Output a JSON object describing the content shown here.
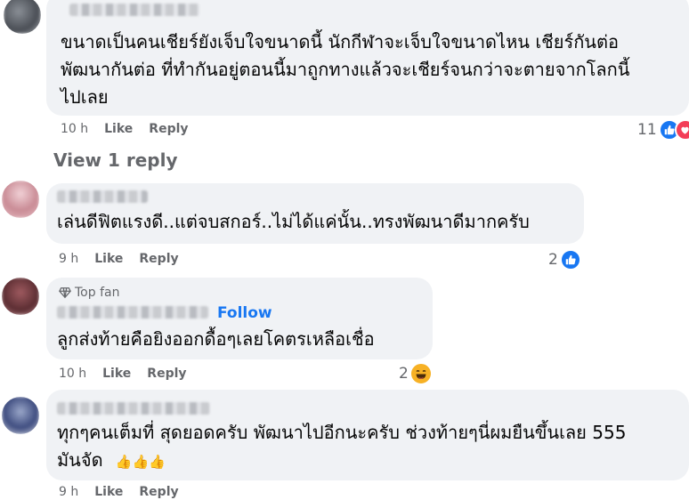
{
  "comments": [
    {
      "text_lines": [
        "ขนาดเป็นคนเชียร์ยังเจ็บใจขนาดนี้ นักกีฬาจะเจ็บใจขนาดไหน เชียร์กันต่อ",
        "พัฒนากันต่อ ที่ทำกันอยู่ตอนนี้มาถูกทางแล้วจะเชียร์จนกว่าจะตายจากโลกนี้",
        "ไปเลย"
      ],
      "time": "10 h",
      "like_label": "Like",
      "reply_label": "Reply",
      "reaction_count": "11",
      "view_replies": "View 1 reply"
    },
    {
      "text_lines": [
        "เล่นดีฟิตแรงดี..แต่จบสกอร์..ไม่ได้แค่นั้น..ทรงพัฒนาดีมากครับ"
      ],
      "time": "9 h",
      "like_label": "Like",
      "reply_label": "Reply",
      "reaction_count": "2"
    },
    {
      "badge": "Top fan",
      "follow_label": "Follow",
      "text_lines": [
        "ลูกส่งท้ายคือยิงออกดื้อๆเลยโคตรเหลือเชื่อ"
      ],
      "time": "10 h",
      "like_label": "Like",
      "reply_label": "Reply",
      "reaction_count": "2"
    },
    {
      "text_lines": [
        "ทุกๆคนเต็มที่ สุดยอดครับ พัฒนาไปอีกนะครับ ช่วงท้ายๆนี่ผมยืนขึ้นเลย 555",
        "มันจัด"
      ],
      "emojis": "👍👍👍",
      "time": "9 h",
      "like_label": "Like",
      "reply_label": "Reply"
    }
  ],
  "icons": {
    "like": "thumbs-up-icon",
    "love": "heart-icon",
    "haha": "laughing-face-icon",
    "topfan": "diamond-icon"
  },
  "colors": {
    "bubble": "#f0f2f5",
    "like_blue": "#1877f2",
    "muted": "#65676b",
    "love_red": "#f33e58",
    "haha_yellow": "#f7b125"
  }
}
